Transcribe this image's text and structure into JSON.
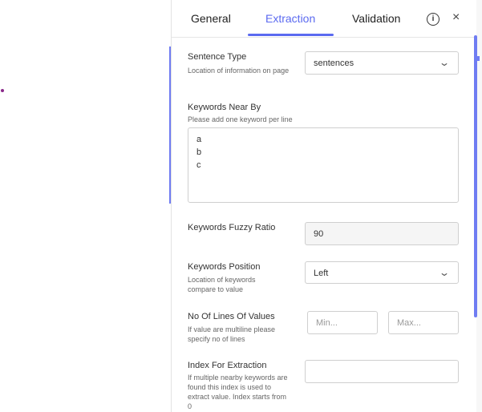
{
  "tabs": {
    "general": "General",
    "extraction": "Extraction",
    "validation": "Validation"
  },
  "icons": {
    "info": "ⓘ",
    "close": "×"
  },
  "fields": {
    "sentence_type": {
      "label": "Sentence Type",
      "help": "Location of information on page",
      "value": "sentences"
    },
    "keywords_near_by": {
      "label": "Keywords Near By",
      "help": "Please add one keyword per line",
      "lines": [
        "a",
        "b",
        "c"
      ]
    },
    "keywords_fuzzy_ratio": {
      "label": "Keywords Fuzzy Ratio",
      "value": "90"
    },
    "keywords_position": {
      "label": "Keywords Position",
      "help": "Location of keywords compare to value",
      "value": "Left"
    },
    "no_of_lines": {
      "label": "No Of Lines Of Values",
      "help": "If value are multiline please specify no of lines",
      "min_placeholder": "Min...",
      "max_placeholder": "Max..."
    },
    "index_for_extraction": {
      "label": "Index For Extraction",
      "help": "If multiple nearby keywords are found this index is used to extract value. Index starts from 0",
      "value": ""
    }
  },
  "colors": {
    "accent": "#5b6af0",
    "border": "#cfcfcf"
  }
}
